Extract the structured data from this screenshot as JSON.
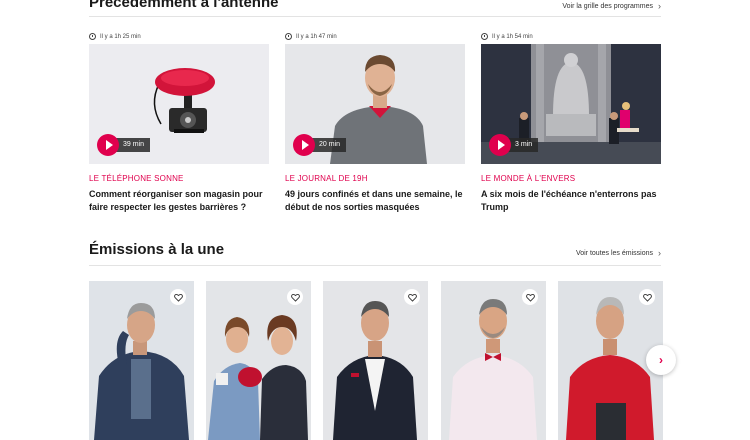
{
  "recent": {
    "title": "Précédemment à l'antenne",
    "link": "Voir la grille des programmes",
    "cards": [
      {
        "ago": "Il y a 1h 25 min",
        "duration": "39 min",
        "show": "Le téléphone sonne",
        "episode": "Comment réorganiser son magasin pour faire respecter les gestes barrières ?"
      },
      {
        "ago": "Il y a 1h 47 min",
        "duration": "20 min",
        "show": "Le journal de 19h",
        "episode": "49 jours confinés et dans une semaine, le début de nos sorties masquées"
      },
      {
        "ago": "Il y a 1h 54 min",
        "duration": "3 min",
        "show": "Le monde à l'envers",
        "episode": "A six mois de l'échéance n'enterrons pas Trump"
      }
    ]
  },
  "featured": {
    "title": "Émissions à la une",
    "link": "Voir toutes les émissions"
  },
  "icons": {
    "clock": "clock-icon",
    "play": "play-icon",
    "heart": "heart-icon",
    "chevron": "chevron-right-icon"
  },
  "colors": {
    "accent": "#e0004d",
    "text": "#1a1a1a"
  }
}
